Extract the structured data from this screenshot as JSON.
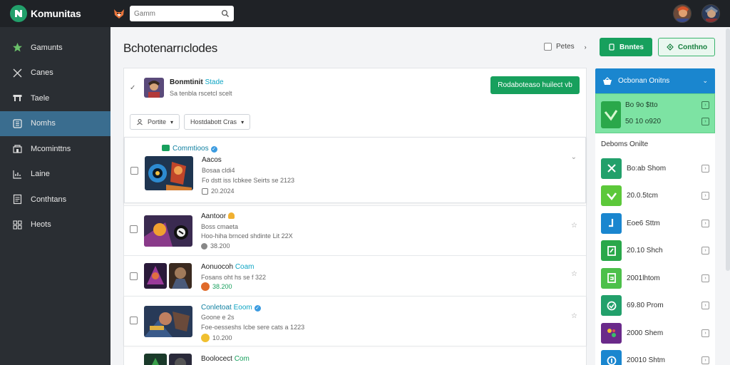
{
  "app": {
    "name": "Komunitas",
    "search_placeholder": "Gamm"
  },
  "sidebar": {
    "items": [
      {
        "label": "Gamunts",
        "icon": "star-icon"
      },
      {
        "label": "Canes",
        "icon": "brush-icon"
      },
      {
        "label": "Taele",
        "icon": "table-icon"
      },
      {
        "label": "Nomhs",
        "icon": "grid-icon"
      },
      {
        "label": "Mcominttns",
        "icon": "people-icon"
      },
      {
        "label": "Laine",
        "icon": "chart-icon"
      },
      {
        "label": "Conthtans",
        "icon": "document-icon"
      },
      {
        "label": "Heots",
        "icon": "squares-icon"
      }
    ]
  },
  "main": {
    "title": "Bchotenarrıclodes",
    "header_check_label": "Petes",
    "primary_button": "Bnntes",
    "outline_button": "Conthno"
  },
  "post": {
    "author": "Bonmtinit",
    "author_tag": "Stade",
    "subtitle": "Sa tenbla rscetcl scelt",
    "follow_button": "Rodaboteaso huilect vb",
    "filters": [
      "Portite",
      "Hostdabott Cras"
    ]
  },
  "rows": [
    {
      "group": "Commtioos",
      "title": "Aacos",
      "sub": "Bosaa cldi4",
      "meta": "Fo dstt iss Icbkee Seirts se 2123",
      "stat": "20.2024"
    },
    {
      "title": "Aantoor",
      "sub": "Boss cmaeta",
      "meta": "Hoo-hiha brnced shdinte Lit 22X",
      "stat": "38.200"
    },
    {
      "title": "Aonuocoh",
      "title_tag": "Coam",
      "sub": "Fosans oht hs se f 322",
      "stat": "38.200"
    },
    {
      "title": "Conletoat",
      "title_tag": "Eoom",
      "sub": "Goone e 2s",
      "meta": "Foe-oesseshs Icbe sere cats a 1223",
      "stat": "10.200"
    },
    {
      "title": "Boolocect",
      "title_tag": "Com"
    }
  ],
  "right_panel": {
    "header": "Ocbonan Onitns",
    "featured": [
      "Bo 9o $tto",
      "50 10 o920"
    ],
    "subheader": "Deboms Onilte",
    "items": [
      {
        "label": "Bo:ab Shom",
        "color": "#22a06b"
      },
      {
        "label": "20.0.5tcm",
        "color": "#5cc83a"
      },
      {
        "label": "Eoe6 Sttm",
        "color": "#1a86cf"
      },
      {
        "label": "20.10 Shch",
        "color": "#2aa84a"
      },
      {
        "label": "2001lhtom",
        "color": "#4cc04a"
      },
      {
        "label": "69.80 Prom",
        "color": "#22a06b"
      },
      {
        "label": "2000 Shem",
        "color": "#6a2a8a"
      },
      {
        "label": "20010 Shtm",
        "color": "#1a86cf"
      }
    ]
  }
}
